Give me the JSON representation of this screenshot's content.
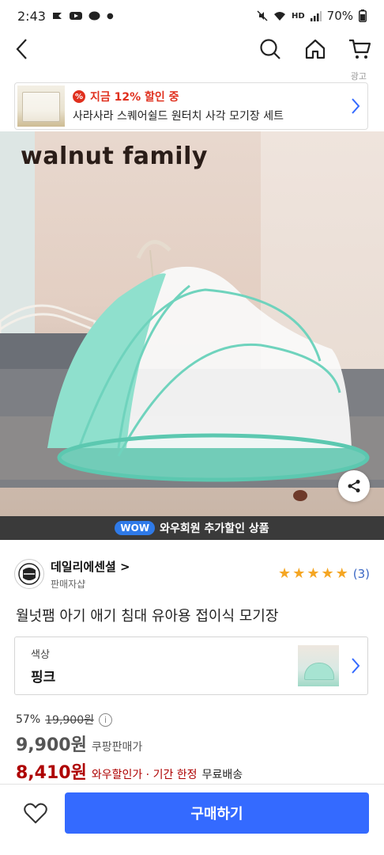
{
  "status_bar": {
    "time": "2:43",
    "battery": "70%",
    "network": "HD"
  },
  "nav": {
    "back_icon": "chevron-left-icon",
    "search_icon": "search-icon",
    "home_icon": "home-icon",
    "cart_icon": "cart-icon"
  },
  "ad": {
    "label": "광고",
    "discount": "지금 12% 할인 중",
    "product": "사라사라 스퀘어쉴드 원터치 사각 모기장 세트",
    "badge": "%"
  },
  "image": {
    "brand_text": "walnut family",
    "share_icon": "share-icon"
  },
  "wow": {
    "badge": "WOW",
    "text": "와우회원 추가할인 상품"
  },
  "seller": {
    "name": "데일리에센셜",
    "chevron": ">",
    "sub": "판매자샵",
    "rating_stars": 5,
    "review_count": "(3)"
  },
  "product": {
    "title": "월넛팸 아기 애기 침대 유아용 접이식 모기장"
  },
  "option": {
    "label": "색상",
    "value": "핑크"
  },
  "pricing": {
    "discount_pct": "57%",
    "original_price": "19,900원",
    "info_icon": "i",
    "coupang_price": "9,900원",
    "coupang_label": "쿠팡판매가",
    "wow_price": "8,410원",
    "wow_label": "와우할인가 · 기간 한정",
    "shipping": "무료배송"
  },
  "bottom": {
    "buy_label": "구매하기",
    "wish_icon": "heart-icon"
  },
  "colors": {
    "accent": "#346aff",
    "wow_price": "#ae0000",
    "ad_red": "#e0301e",
    "wow_badge": "#2f7ae8",
    "star": "#f5a623"
  }
}
